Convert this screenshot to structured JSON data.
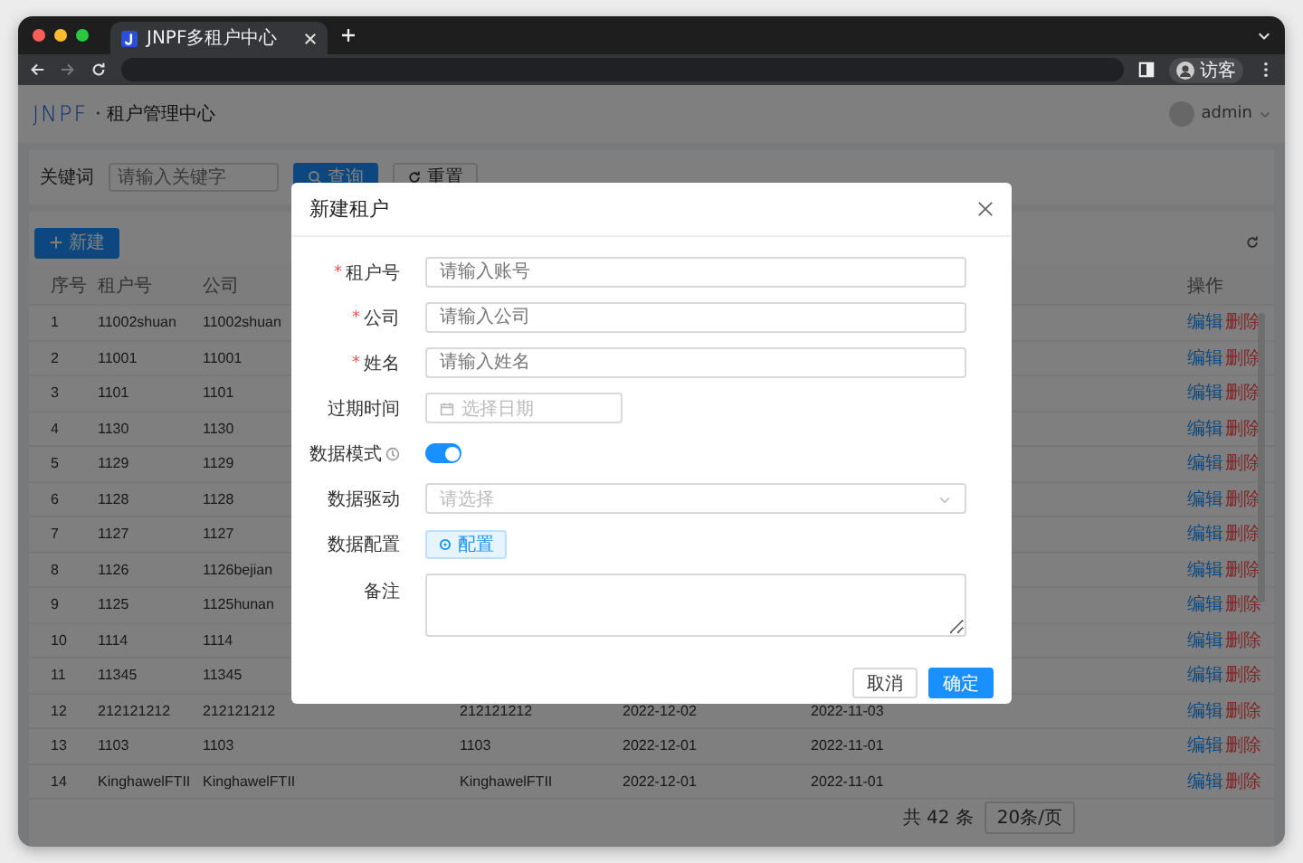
{
  "browser": {
    "tab_title": "JNPF多租户中心",
    "profile": "访客"
  },
  "header": {
    "logo": "JNPF",
    "title": "· 租户管理中心",
    "user": "admin"
  },
  "search": {
    "label": "关键词",
    "placeholder": "请输入关键字",
    "query_button": "查询",
    "reset_button": "重置"
  },
  "toolbar": {
    "new_button": "新建"
  },
  "table": {
    "columns": [
      "序号",
      "租户号",
      "公司"
    ],
    "action_column": "操作",
    "rows": [
      {
        "cells": [
          "1",
          "11002shuan",
          "11002shuan"
        ],
        "actions": [
          "编辑",
          "删除"
        ]
      },
      {
        "cells": [
          "2",
          "11001",
          "11001"
        ],
        "actions": [
          "编辑",
          "删除"
        ]
      },
      {
        "cells": [
          "3",
          "1101",
          "1101"
        ],
        "actions": [
          "编辑",
          "删除"
        ]
      },
      {
        "cells": [
          "4",
          "1130",
          "1130"
        ],
        "actions": [
          "编辑",
          "删除"
        ]
      },
      {
        "cells": [
          "5",
          "1129",
          "1129"
        ],
        "actions": [
          "编辑",
          "删除"
        ]
      },
      {
        "cells": [
          "6",
          "1128",
          "1128"
        ],
        "actions": [
          "编辑",
          "删除"
        ]
      },
      {
        "cells": [
          "7",
          "1127",
          "1127"
        ],
        "actions": [
          "编辑",
          "删除"
        ]
      },
      {
        "cells": [
          "8",
          "1126",
          "1126bejian"
        ],
        "actions": [
          "编辑",
          "删除"
        ]
      },
      {
        "cells": [
          "9",
          "1125",
          "1125hunan"
        ],
        "actions": [
          "编辑",
          "删除"
        ]
      },
      {
        "cells": [
          "10",
          "1114",
          "1114"
        ],
        "actions": [
          "编辑",
          "删除"
        ]
      },
      {
        "cells": [
          "11",
          "11345",
          "11345"
        ],
        "actions": [
          "编辑",
          "删除"
        ]
      },
      {
        "cells": [
          "12",
          "212121212",
          "212121212",
          "212121212",
          "2022-12-02",
          "2022-11-03"
        ],
        "actions": [
          "编辑",
          "删除"
        ]
      },
      {
        "cells": [
          "13",
          "1103",
          "1103",
          "1103",
          "2022-12-01",
          "2022-11-01"
        ],
        "actions": [
          "编辑",
          "删除"
        ]
      },
      {
        "cells": [
          "14",
          "KinghawelFTII",
          "KinghawelFTII",
          "KinghawelFTII",
          "2022-12-01",
          "2022-11-01"
        ],
        "actions": [
          "编辑",
          "删除"
        ]
      }
    ]
  },
  "pagination": {
    "total": "共 42 条",
    "page_size": "20条/页"
  },
  "dialog": {
    "title": "新建租户",
    "fields": [
      {
        "kind": "input",
        "label": "租户号",
        "required_mark": "*",
        "placeholder": "请输入账号"
      },
      {
        "kind": "input",
        "label": "公司",
        "required_mark": "*",
        "placeholder": "请输入公司"
      },
      {
        "kind": "input",
        "label": "姓名",
        "required_mark": "*",
        "placeholder": "请输入姓名"
      },
      {
        "kind": "date",
        "label": "过期时间",
        "placeholder": "选择日期"
      },
      {
        "kind": "switch",
        "label": "数据模式",
        "on": true
      },
      {
        "kind": "select",
        "label": "数据驱动",
        "placeholder": "请选择"
      },
      {
        "kind": "button",
        "label": "数据配置",
        "button": "配置"
      },
      {
        "kind": "textarea",
        "label": "备注"
      }
    ],
    "cancel": "取消",
    "confirm": "确定"
  }
}
